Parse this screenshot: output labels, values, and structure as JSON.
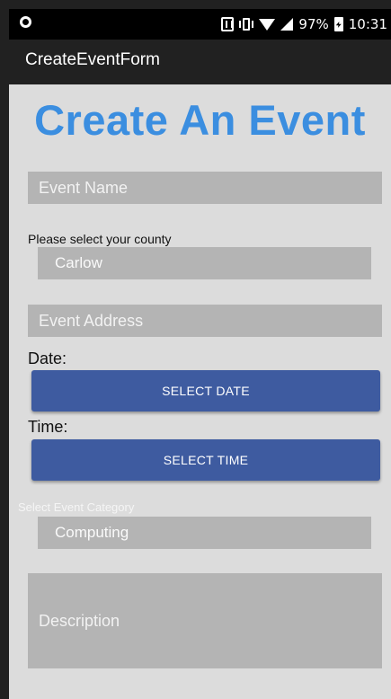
{
  "status_bar": {
    "battery_percent": "97%",
    "time": "10:31"
  },
  "app_bar": {
    "title": "CreateEventForm"
  },
  "form": {
    "heading": "Create An Event",
    "event_name_placeholder": "Event Name",
    "county_label": "Please select your county",
    "county_selected": "Carlow",
    "event_address_placeholder": "Event Address",
    "date_label": "Date:",
    "select_date_button": "SELECT DATE",
    "time_label": "Time:",
    "select_time_button": "SELECT TIME",
    "category_label": "Select Event Category",
    "category_selected": "Computing",
    "description_placeholder": "Description"
  },
  "colors": {
    "heading": "#3b8ee0",
    "button": "#3e5ba0",
    "field_bg": "#b4b4b4",
    "screen_bg": "#dcdcdc"
  }
}
